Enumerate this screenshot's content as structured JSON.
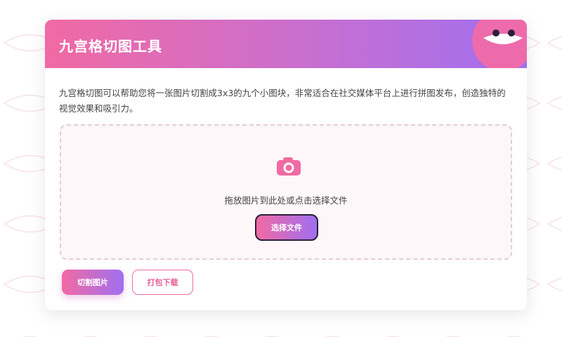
{
  "header": {
    "title": "九宫格切图工具"
  },
  "description": "九宫格切图可以帮助您将一张图片切割成3x3的九个小图块，非常适合在社交媒体平台上进行拼图发布，创造独特的视觉效果和吸引力。",
  "dropzone": {
    "icon": "camera-icon",
    "text": "拖放图片到此处或点击选择文件",
    "button_label": "选择文件"
  },
  "actions": {
    "cut_label": "切割图片",
    "download_label": "打包下载"
  },
  "colors": {
    "gradient_start": "#f16aa3",
    "gradient_end": "#a06ff0",
    "accent_pink": "#e85d97",
    "dropzone_bg": "#fdf7fa"
  }
}
